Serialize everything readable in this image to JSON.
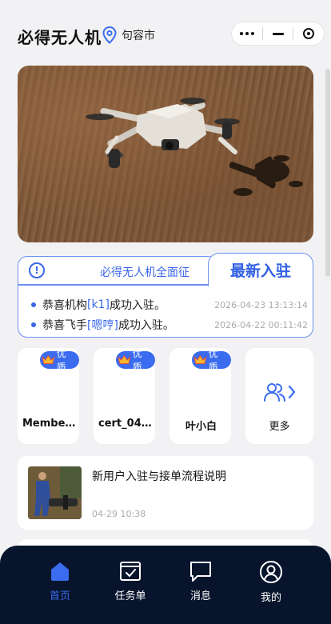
{
  "header": {
    "app_title": "必得无人机",
    "location": "句容市"
  },
  "notice": {
    "marquee": "必得无人机全面征",
    "tab_title": "最新入驻",
    "items": [
      {
        "prefix": "恭喜机构",
        "highlight": "[k1]",
        "suffix": "成功入驻。",
        "time": "2026-04-23 13:13:14"
      },
      {
        "prefix": "恭喜飞手",
        "highlight": "[嗯哼]",
        "suffix": "成功入驻。",
        "time": "2026-04-22 00:11:42"
      }
    ]
  },
  "members": [
    {
      "badge": "优质",
      "name": "Membe..."
    },
    {
      "badge": "优质",
      "name": "cert_04..."
    },
    {
      "badge": "优质",
      "name": "叶小白"
    }
  ],
  "more_label": "更多",
  "article": {
    "title": "新用户入驻与接单流程说明",
    "time": "04-29 10:38"
  },
  "tabbar": {
    "items": [
      {
        "label": "首页",
        "icon": "home-icon",
        "active": true
      },
      {
        "label": "任务单",
        "icon": "task-icon",
        "active": false
      },
      {
        "label": "消息",
        "icon": "message-icon",
        "active": false
      },
      {
        "label": "我的",
        "icon": "profile-icon",
        "active": false
      }
    ]
  },
  "colors": {
    "accent": "#3b6cf0",
    "tabbar_bg": "#07142c",
    "background": "#f2f2f4"
  }
}
